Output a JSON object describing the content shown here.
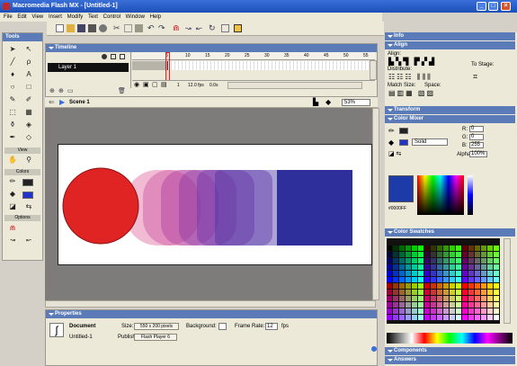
{
  "window": {
    "title": "Macromedia Flash MX - [Untitled-1]"
  },
  "menu": {
    "items": [
      "File",
      "Edit",
      "View",
      "Insert",
      "Modify",
      "Text",
      "Control",
      "Window",
      "Help"
    ]
  },
  "tools": {
    "title": "Tools",
    "view_label": "View",
    "colors_label": "Colors",
    "options_label": "Options"
  },
  "timeline": {
    "title": "Timeline",
    "layer_name": "Layer 1",
    "frame_numbers": [
      "5",
      "10",
      "15",
      "20",
      "25",
      "30",
      "35",
      "40",
      "45",
      "50",
      "55"
    ],
    "current_frame": "1",
    "fps": "12.0 fps",
    "elapsed": "0.0s"
  },
  "scene": {
    "name": "Scene 1",
    "zoom": "53%"
  },
  "properties": {
    "title": "Properties",
    "doc_type": "Document",
    "doc_name": "Untitled-1",
    "size_label": "Size:",
    "size_value": "550 x 200 pixels",
    "background_label": "Background:",
    "frame_rate_label": "Frame Rate:",
    "frame_rate_value": "12",
    "fps_unit": "fps",
    "publish_label": "Publish:",
    "publish_value": "Flash Player 6"
  },
  "right_panels": {
    "info": "Info",
    "align": "Align",
    "align_label": "Align:",
    "distribute_label": "Distribute:",
    "match_size_label": "Match Size:",
    "space_label": "Space:",
    "to_stage_label": "To Stage:",
    "transform": "Transform",
    "color_mixer": "Color Mixer",
    "fill_style": "Solid",
    "r_label": "R:",
    "g_label": "G:",
    "b_label": "B:",
    "r_value": "0",
    "g_value": "0",
    "b_value": "255",
    "alpha_label": "Alpha:",
    "alpha_value": "100%",
    "hex_value": "#0000FF",
    "color_swatches": "Color Swatches",
    "components": "Components",
    "answers": "Answers"
  },
  "colors": {
    "accent": "#5a7bb8",
    "circle": "#e02424",
    "square": "#2e2f9b"
  }
}
